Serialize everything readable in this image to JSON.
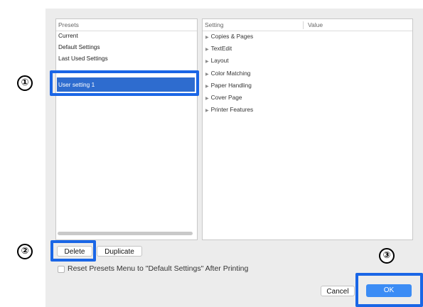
{
  "presets": {
    "header": "Presets",
    "items": [
      "Current",
      "Default Settings",
      "Last Used Settings"
    ],
    "selected": "User setting 1"
  },
  "settings": {
    "headers": {
      "setting": "Setting",
      "value": "Value"
    },
    "rows": [
      "Copies & Pages",
      "TextEdit",
      "Layout",
      "Color Matching",
      "Paper Handling",
      "Cover Page",
      "Printer Features"
    ]
  },
  "buttons": {
    "delete": "Delete",
    "duplicate": "Duplicate",
    "cancel": "Cancel",
    "ok": "OK"
  },
  "reset_checkbox": {
    "label": "Reset Presets Menu to \"Default Settings\" After Printing",
    "checked": false
  },
  "callouts": [
    "①",
    "②",
    "③"
  ],
  "colors": {
    "selection": "#2e6ccf",
    "callout": "#1a66e6",
    "ok_button": "#3b8cf5"
  }
}
